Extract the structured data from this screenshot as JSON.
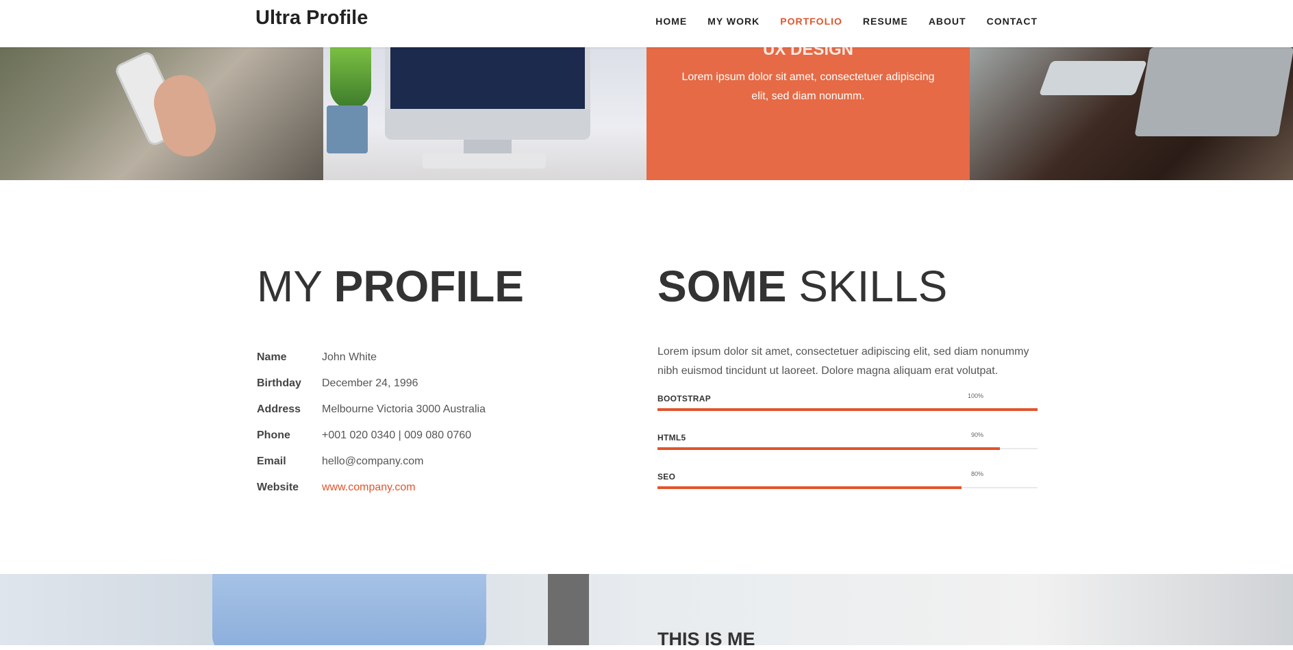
{
  "header": {
    "brand": "Ultra Profile",
    "nav": [
      {
        "label": "HOME"
      },
      {
        "label": "MY WORK"
      },
      {
        "label": "PORTFOLIO",
        "active": true
      },
      {
        "label": "RESUME"
      },
      {
        "label": "ABOUT"
      },
      {
        "label": "CONTACT"
      }
    ]
  },
  "portfolio": {
    "overlay_title": "UX DESIGN",
    "overlay_text": "Lorem ipsum dolor sit amet, consectetuer adipiscing elit, sed diam nonumm."
  },
  "profile": {
    "title_light": "MY",
    "title_bold": "PROFILE",
    "rows": [
      {
        "label": "Name",
        "value": "John White"
      },
      {
        "label": "Birthday",
        "value": "December 24, 1996"
      },
      {
        "label": "Address",
        "value": "Melbourne Victoria 3000 Australia"
      },
      {
        "label": "Phone",
        "value": "+001 020 0340 | 009 080 0760"
      },
      {
        "label": "Email",
        "value": "hello@company.com"
      },
      {
        "label": "Website",
        "value": "www.company.com"
      }
    ]
  },
  "skills": {
    "title_bold": "SOME",
    "title_light": "SKILLS",
    "intro": "Lorem ipsum dolor sit amet, consectetuer adipiscing elit, sed diam nonummy nibh euismod tincidunt ut laoreet. Dolore magna aliquam erat volutpat.",
    "items": [
      {
        "name": "BOOTSTRAP",
        "percent_label": "100%",
        "percent": 100
      },
      {
        "name": "HTML5",
        "percent_label": "90%",
        "percent": 90
      },
      {
        "name": "SEO",
        "percent_label": "80%",
        "percent": 80
      }
    ]
  },
  "about": {
    "title_light": "THIS IS",
    "title_bold": "ME"
  },
  "colors": {
    "accent": "#e2542b"
  }
}
